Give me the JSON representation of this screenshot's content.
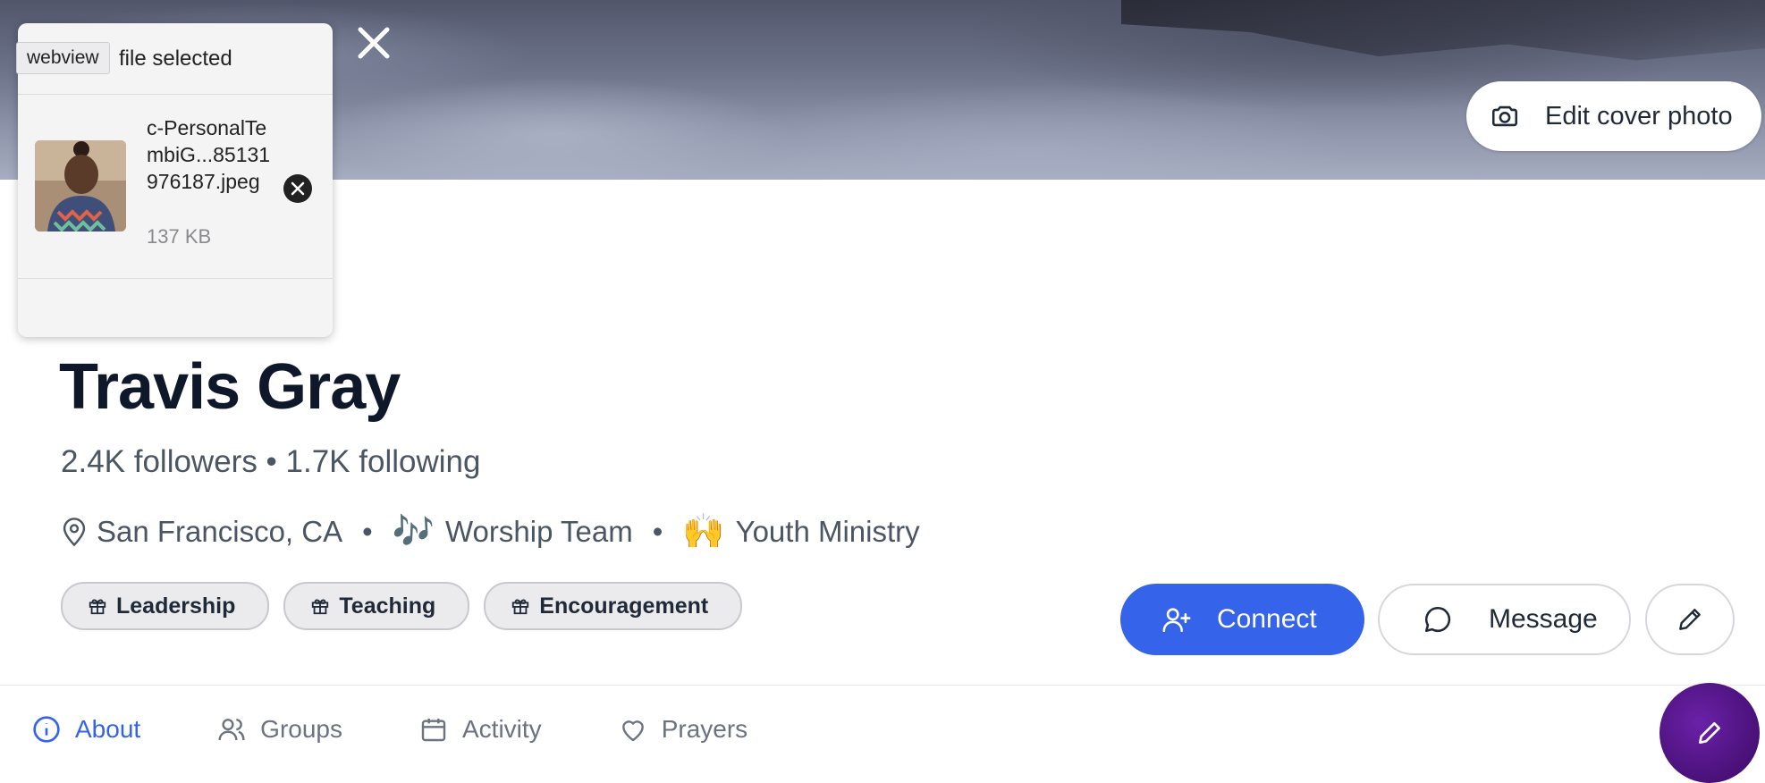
{
  "cover": {
    "edit_label": "Edit cover photo"
  },
  "file_picker": {
    "title": "file selected",
    "tooltip": "webview",
    "file": {
      "name": "c-PersonalTembiG...85131976187.jpeg",
      "size": "137 KB"
    }
  },
  "profile": {
    "name": "Travis Gray",
    "stats": "2.4K followers • 1.7K following",
    "location": "San Francisco, CA",
    "separator": "•",
    "team_emoji": "🎶",
    "team": "Worship Team",
    "ministry_emoji": "🙌",
    "ministry": "Youth Ministry",
    "gifts": [
      "Leadership",
      "Teaching",
      "Encouragement"
    ]
  },
  "actions": {
    "connect": "Connect",
    "message": "Message"
  },
  "tabs": [
    {
      "label": "About",
      "icon": "info-icon",
      "active": true
    },
    {
      "label": "Groups",
      "icon": "users-icon"
    },
    {
      "label": "Activity",
      "icon": "calendar-icon"
    },
    {
      "label": "Prayers",
      "icon": "heart-icon"
    }
  ],
  "colors": {
    "accent": "#3563e9",
    "fab": "#4c1d95"
  }
}
